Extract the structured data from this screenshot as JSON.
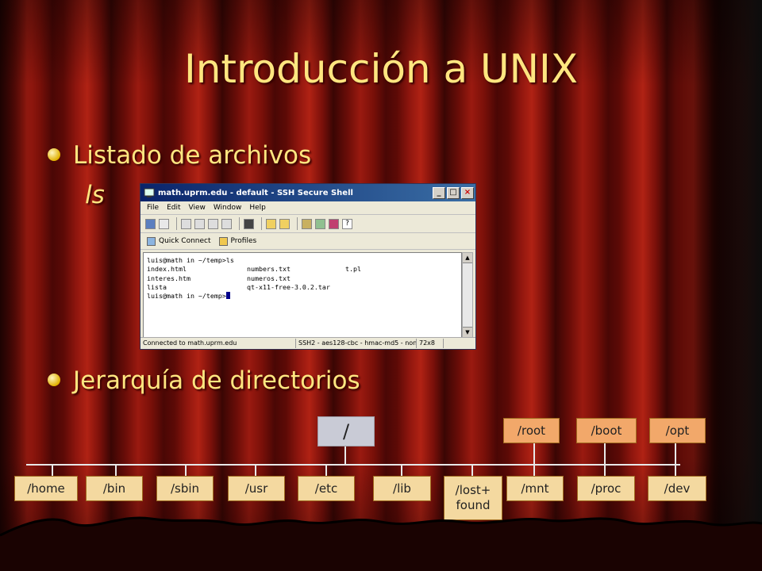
{
  "slide": {
    "title": "Introducción a UNIX",
    "bullets": [
      {
        "label": "Listado de archivos",
        "sub": "ls"
      },
      {
        "label": "Jerarquía de directorios"
      }
    ]
  },
  "ssh_window": {
    "title": "math.uprm.edu - default - SSH Secure Shell",
    "menu": [
      "File",
      "Edit",
      "View",
      "Window",
      "Help"
    ],
    "toolbar2": {
      "quick_connect": "Quick Connect",
      "profiles": "Profiles"
    },
    "terminal": {
      "prompt_cmd": "luis@math in ~/temp>ls",
      "rows": [
        [
          "index.html",
          "numbers.txt",
          "t.pl"
        ],
        [
          "interes.htm",
          "numeros.txt",
          ""
        ],
        [
          "lista",
          "qt-x11-free-3.0.2.tar",
          ""
        ]
      ],
      "prompt_end": "luis@math in ~/temp>"
    },
    "status": {
      "connection": "Connected to math.uprm.edu",
      "cipher": "SSH2 - aes128-cbc - hmac-md5 - none",
      "size": "72x8"
    }
  },
  "directory_tree": {
    "root": "/",
    "bottom_row": [
      "/home",
      "/bin",
      "/sbin",
      "/usr",
      "/etc",
      "/lib",
      "/lost+ found",
      "/mnt",
      "/proc",
      "/dev"
    ],
    "top_row": [
      "/root",
      "/boot",
      "/opt"
    ]
  }
}
